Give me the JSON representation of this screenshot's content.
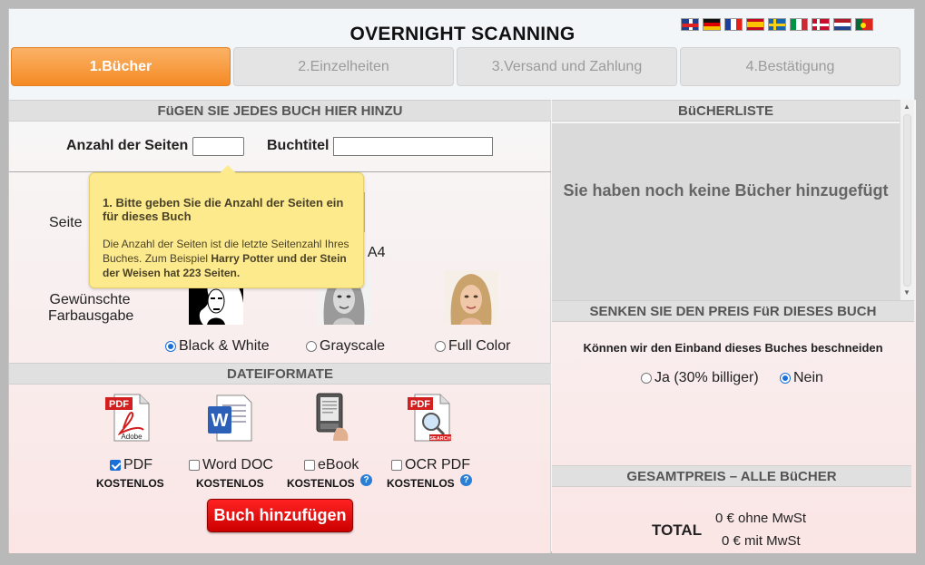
{
  "header": {
    "title": "OVERNIGHT SCANNING",
    "languages": [
      "gb",
      "de",
      "fr",
      "es",
      "se",
      "it",
      "dk",
      "nl",
      "pt"
    ]
  },
  "steps": [
    {
      "label": "1.Bücher",
      "active": true
    },
    {
      "label": "2.Einzelheiten",
      "active": false
    },
    {
      "label": "3.Versand und Zahlung",
      "active": false
    },
    {
      "label": "4.Bestätigung",
      "active": false
    }
  ],
  "left": {
    "add_header": "FüGEN SIE JEDES BUCH HIER HINZU",
    "pages_label": "Anzahl der Seiten",
    "pages_value": "",
    "title_label": "Buchtitel",
    "title_value": "",
    "size_label_fragment": "Seite",
    "size_option_fragment": "- A4",
    "color_label_line1": "Gewünschte",
    "color_label_line2": "Farbausgabe",
    "color_options": [
      {
        "label": "Black & White",
        "checked": true
      },
      {
        "label": "Grayscale",
        "checked": false
      },
      {
        "label": "Full Color",
        "checked": false
      }
    ],
    "formats_header": "DATEIFORMATE",
    "formats": [
      {
        "label": "PDF",
        "checked": true,
        "price": "KOSTENLOS",
        "help": false,
        "icon": "pdf-adobe-icon"
      },
      {
        "label": "Word DOC",
        "checked": false,
        "price": "KOSTENLOS",
        "help": false,
        "icon": "word-doc-icon"
      },
      {
        "label": "eBook",
        "checked": false,
        "price": "KOSTENLOS",
        "help": true,
        "icon": "ebook-reader-icon"
      },
      {
        "label": "OCR PDF",
        "checked": false,
        "price": "KOSTENLOS",
        "help": true,
        "icon": "pdf-search-icon"
      }
    ],
    "add_button": "Buch hinzufügen",
    "icon_pdf_text": "PDF",
    "icon_adobe_text": "Adobe",
    "icon_search_text": "SEARCH",
    "help_glyph": "?"
  },
  "tooltip": {
    "title": "1. Bitte geben Sie die Anzahl der Seiten ein für dieses Buch",
    "body_plain": "Die Anzahl der Seiten ist die letzte Seitenzahl Ihres Buches. Zum Beispiel ",
    "body_bold": "Harry Potter und der Stein der Weisen hat 223 Seiten."
  },
  "right": {
    "booklist_header": "BüCHERLISTE",
    "booklist_empty": "Sie haben noch keine Bücher hinzugefügt",
    "lower_header": "SENKEN SIE DEN PREIS FüR DIESES BUCH",
    "question": "Können wir den Einband dieses Buches beschneiden",
    "options": [
      {
        "label": "Ja (30% billiger)",
        "checked": false
      },
      {
        "label": "Nein",
        "checked": true
      }
    ],
    "total_header": "GESAMTPREIS – ALLE BüCHER",
    "total_label": "TOTAL",
    "price_net": "0 € ohne MwSt",
    "price_gross": "0 € mit MwSt"
  },
  "colors": {
    "accent_orange": "#f48a25",
    "button_red": "#e00000",
    "tooltip_yellow": "#fdea8c",
    "radio_blue": "#1a6fd8"
  }
}
